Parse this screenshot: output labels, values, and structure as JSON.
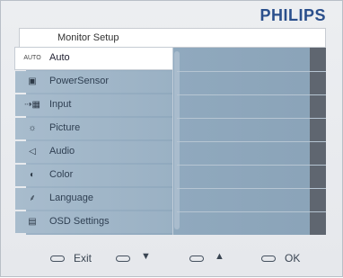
{
  "brand": "PHILIPS",
  "window_title": "Monitor Setup",
  "menu": [
    {
      "icon_text": "AUTO",
      "icon": "auto-icon",
      "label": "Auto",
      "active": true
    },
    {
      "icon_text": "▣",
      "icon": "powersensor-icon",
      "label": "PowerSensor",
      "active": false
    },
    {
      "icon_text": "⇢▦",
      "icon": "input-icon",
      "label": "Input",
      "active": false
    },
    {
      "icon_text": "☼",
      "icon": "picture-icon",
      "label": "Picture",
      "active": false
    },
    {
      "icon_text": "◁",
      "icon": "audio-icon",
      "label": "Audio",
      "active": false
    },
    {
      "icon_text": "◐",
      "icon": "color-icon",
      "label": "Color",
      "active": false
    },
    {
      "icon_text": "⸙",
      "icon": "language-icon",
      "label": "Language",
      "active": false
    },
    {
      "icon_text": "▤",
      "icon": "osd-settings-icon",
      "label": "OSD Settings",
      "active": false
    }
  ],
  "footer": {
    "exit": "Exit",
    "down": "▼",
    "up": "▲",
    "ok": "OK"
  },
  "colors": {
    "brand": "#2a4f8c",
    "panel": "#9db3c6",
    "active_item": "#ffffff"
  }
}
